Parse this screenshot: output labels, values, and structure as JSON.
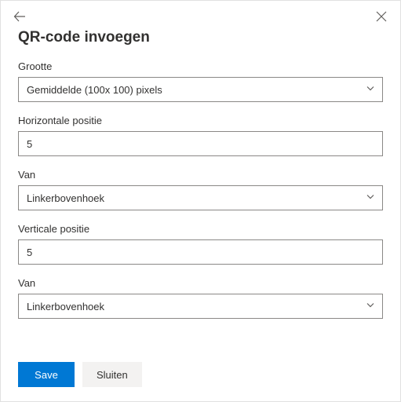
{
  "title": "QR-code invoegen",
  "fields": {
    "size": {
      "label": "Grootte",
      "value": "Gemiddelde (100x 100) pixels"
    },
    "hpos": {
      "label": "Horizontale positie",
      "value": "5"
    },
    "hfrom": {
      "label": "Van",
      "value": "Linkerbovenhoek"
    },
    "vpos": {
      "label": "Verticale positie",
      "value": "5"
    },
    "vfrom": {
      "label": "Van",
      "value": "Linkerbovenhoek"
    }
  },
  "buttons": {
    "save": "Save",
    "close": "Sluiten"
  }
}
